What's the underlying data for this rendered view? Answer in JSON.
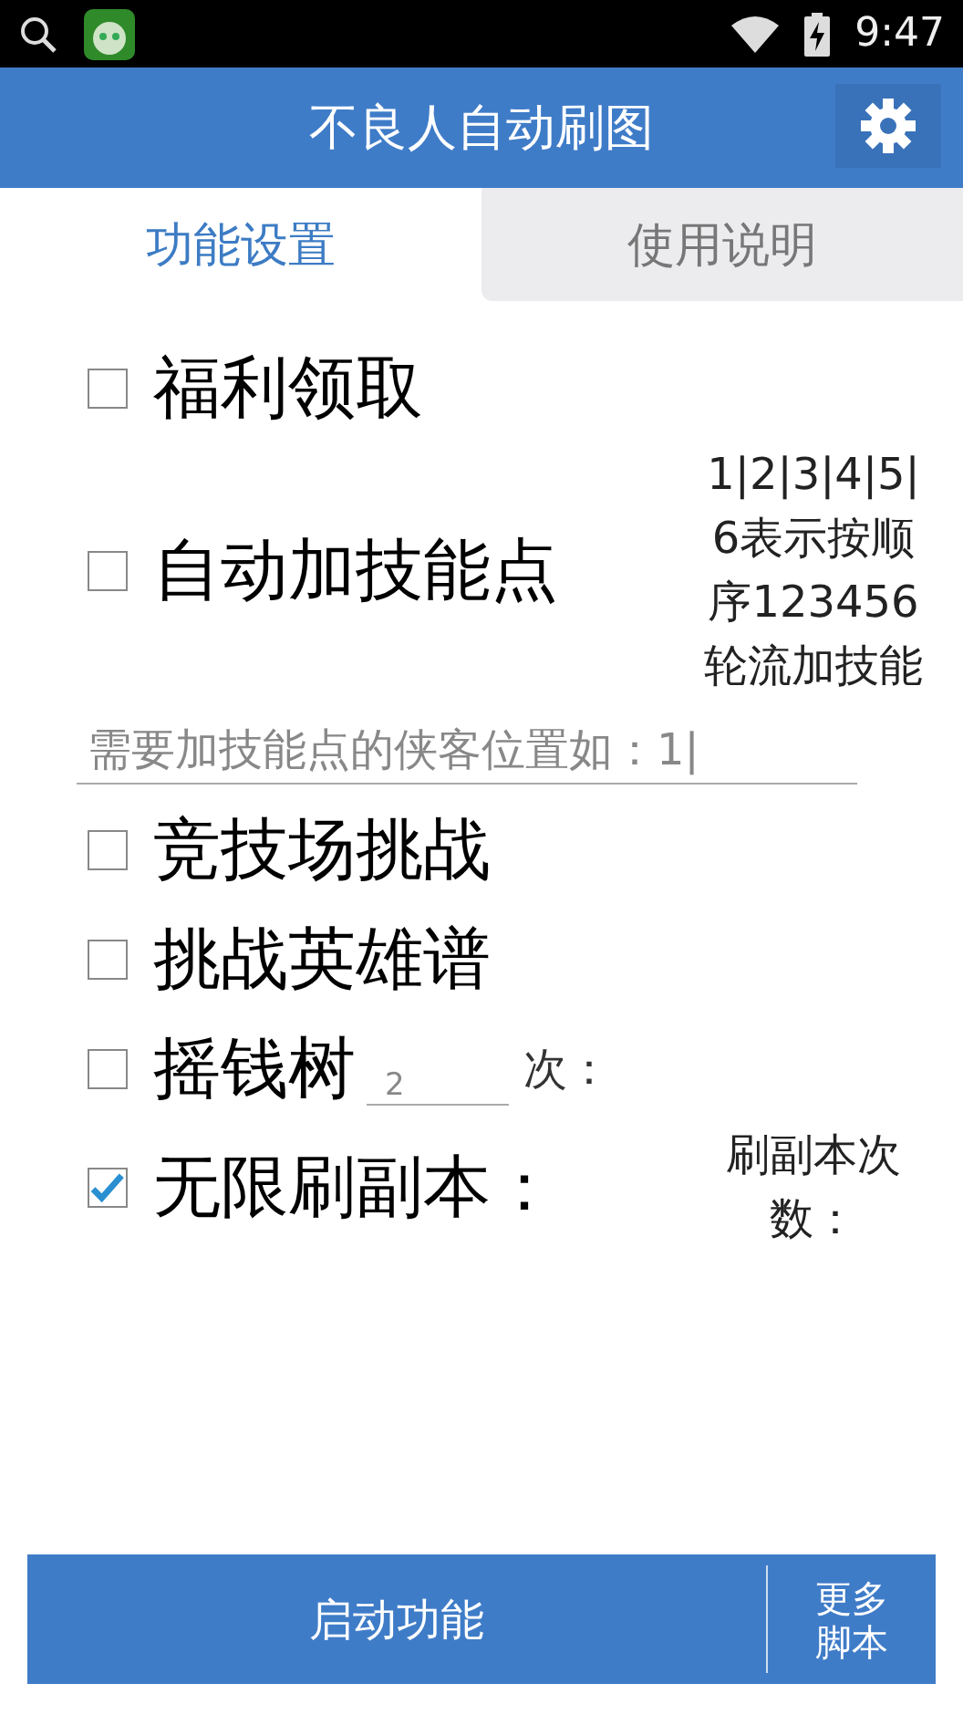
{
  "status_bar": {
    "time": "9:47"
  },
  "app_bar": {
    "title": "不良人自动刷图"
  },
  "tabs": [
    {
      "label": "功能设置",
      "selected": true
    },
    {
      "label": "使用说明",
      "selected": false
    }
  ],
  "options": [
    {
      "kind": "check",
      "label": "福利领取",
      "checked": false
    },
    {
      "kind": "check",
      "label": "自动加技能点",
      "checked": false,
      "note": "1|2|3|4|5|6表示按顺序123456轮流加技能"
    },
    {
      "kind": "field",
      "placeholder": "需要加技能点的侠客位置如：1|"
    },
    {
      "kind": "check",
      "label": "竞技场挑战",
      "checked": false
    },
    {
      "kind": "check",
      "label": "挑战英雄谱",
      "checked": false
    },
    {
      "kind": "check",
      "label": "摇钱树",
      "checked": false,
      "count": {
        "placeholder": "2",
        "suffix": "次："
      }
    },
    {
      "kind": "check",
      "label": "无限刷副本：",
      "checked": true,
      "note": "刷副本次数："
    }
  ],
  "buttons": {
    "start": "启动功能",
    "more": "更多脚本"
  }
}
